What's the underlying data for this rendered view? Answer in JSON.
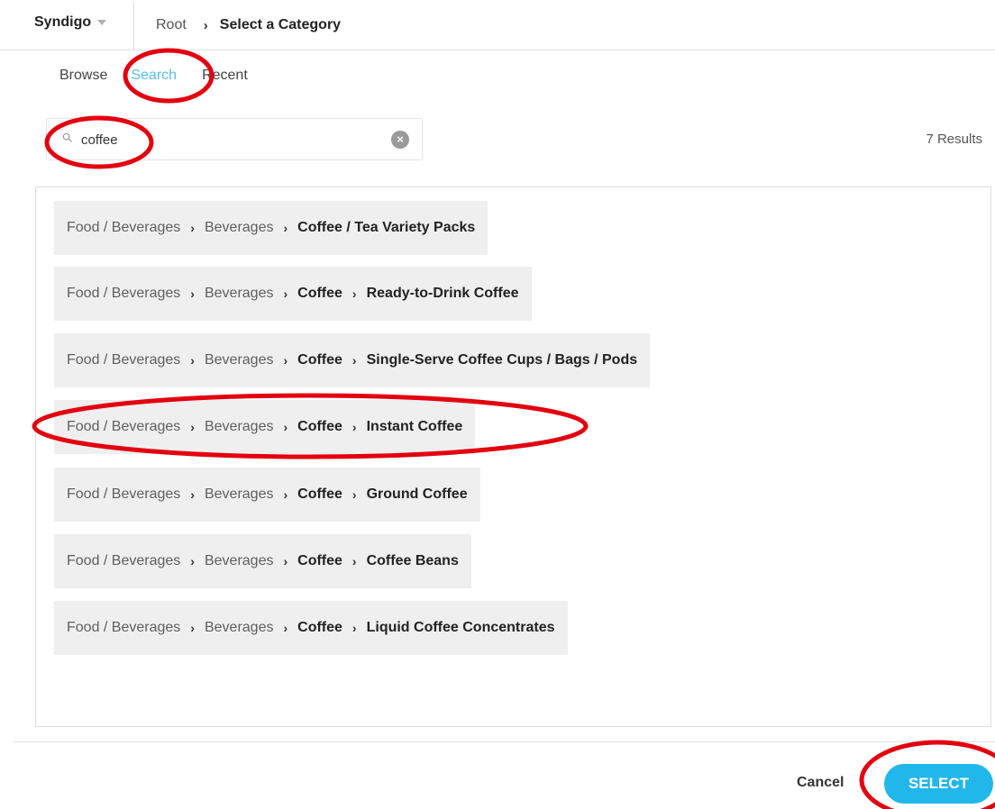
{
  "header": {
    "brand": "Syndigo",
    "breadcrumb": {
      "root": "Root",
      "separator": "›",
      "current": "Select a Category"
    }
  },
  "tabs": [
    {
      "label": "Browse",
      "active": false
    },
    {
      "label": "Search",
      "active": true
    },
    {
      "label": "Recent",
      "active": false
    }
  ],
  "search": {
    "value": "coffee",
    "placeholder": "",
    "clear_icon": "×"
  },
  "results": {
    "count_label": "7 Results",
    "chevron": "›",
    "items": [
      {
        "path": [
          "Food / Beverages",
          "Beverages",
          "Coffee / Tea Variety Packs"
        ],
        "bold_from": 2
      },
      {
        "path": [
          "Food / Beverages",
          "Beverages",
          "Coffee",
          "Ready-to-Drink Coffee"
        ],
        "bold_from": 2
      },
      {
        "path": [
          "Food / Beverages",
          "Beverages",
          "Coffee",
          "Single-Serve Coffee Cups / Bags / Pods"
        ],
        "bold_from": 2
      },
      {
        "path": [
          "Food / Beverages",
          "Beverages",
          "Coffee",
          "Instant Coffee"
        ],
        "bold_from": 2
      },
      {
        "path": [
          "Food / Beverages",
          "Beverages",
          "Coffee",
          "Ground Coffee"
        ],
        "bold_from": 2
      },
      {
        "path": [
          "Food / Beverages",
          "Beverages",
          "Coffee",
          "Coffee Beans"
        ],
        "bold_from": 2
      },
      {
        "path": [
          "Food / Beverages",
          "Beverages",
          "Coffee",
          "Liquid Coffee Concentrates"
        ],
        "bold_from": 2
      }
    ]
  },
  "footer": {
    "cancel_label": "Cancel",
    "select_label": "SELECT"
  },
  "colors": {
    "accent": "#22b7ea",
    "active_tab": "#5bbde4",
    "annotation": "#e3000f",
    "row_bg": "#efefef"
  }
}
